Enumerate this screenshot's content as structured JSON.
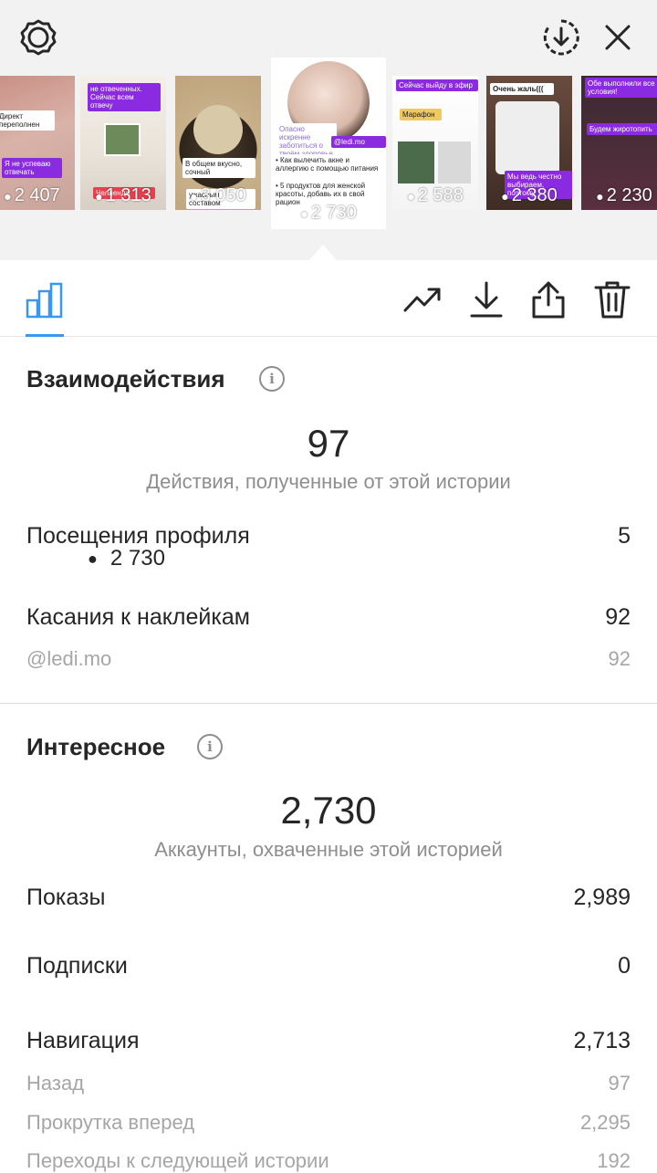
{
  "thumbnails": [
    {
      "views": "2 407",
      "caption_a": "Директ переполнен",
      "caption_b": "Я не успеваю отвечать"
    },
    {
      "views": "1 313",
      "caption_a": "не отвеченных. Сейчас всем отвечу",
      "caption_b": "Челлендж"
    },
    {
      "views": "3 050",
      "caption_a": "В общем вкусно, сочный",
      "caption_b": "ужасным составом"
    },
    {
      "views": "2 730",
      "caption_a": "Опасно искренне заботиться о твоём здоровье",
      "caption_b": "• Как вылечить акне и аллергию с помощью питания",
      "caption_c": "• 5 продуктов для женской красоты, добавь их в свой рацион",
      "caption_d": "@ledi.mo"
    },
    {
      "views": "2 588",
      "caption_a": "Сейчас выйду в эфир",
      "caption_b": "Марафон"
    },
    {
      "views": "2 380",
      "caption_a": "Очень жаль(((",
      "caption_b": "Мы ведь честно выбираем, поэтому"
    },
    {
      "views": "2 230",
      "caption_a": "Обе выполнили все условия!",
      "caption_b": "Будем жиротопить"
    }
  ],
  "toolbar": {
    "views": "2 730"
  },
  "interactions": {
    "title": "Взаимодействия",
    "total": "97",
    "total_caption": "Действия, полученные от этой истории",
    "rows": [
      {
        "label": "Посещения профиля",
        "value": "5"
      },
      {
        "label": "Касания к наклейкам",
        "value": "92"
      },
      {
        "label": "@ledi.mo",
        "value": "92"
      }
    ]
  },
  "discovery": {
    "title": "Интересное",
    "total": "2,730",
    "total_caption": "Аккаунты, охваченные этой историей",
    "rows": [
      {
        "label": "Показы",
        "value": "2,989"
      },
      {
        "label": "Подписки",
        "value": "0"
      },
      {
        "label": "Навигация",
        "value": "2,713"
      },
      {
        "label": "Назад",
        "value": "97"
      },
      {
        "label": "Прокрутка вперед",
        "value": "2,295"
      },
      {
        "label": "Переходы к следующей истории",
        "value": "192"
      }
    ]
  },
  "icons": {
    "settings": "settings-icon",
    "save": "save-circle-icon",
    "close": "close-icon",
    "insights": "bar-chart-icon",
    "eye": "eye-icon",
    "promote": "trend-icon",
    "download": "download-icon",
    "share": "share-icon",
    "delete": "trash-icon",
    "info": "info-icon"
  },
  "colors": {
    "accent": "#3897f0",
    "muted": "#8e8e8e"
  }
}
